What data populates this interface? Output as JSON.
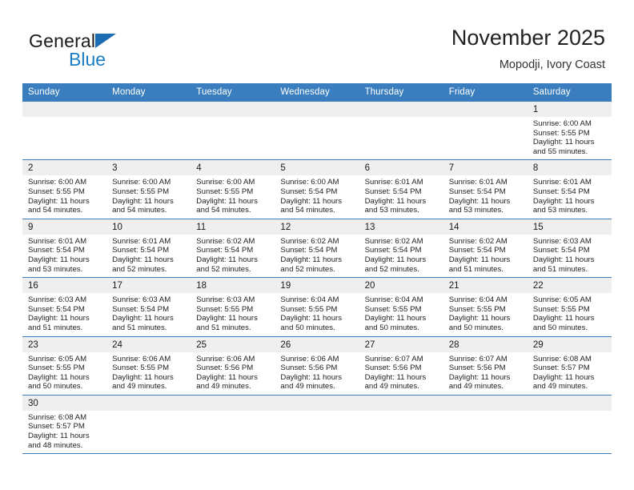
{
  "brand": {
    "name_top": "General",
    "name_bottom": "Blue",
    "accent_color": "#1b6cb3",
    "blue_text_color": "#1b7ec4",
    "triangle_icon": "triangle-icon"
  },
  "header": {
    "title": "November 2025",
    "subtitle": "Mopodji, Ivory Coast"
  },
  "calendar": {
    "header_bg": "#3a7ebf",
    "daynum_bg": "#efefef",
    "weekday_headers": [
      "Sunday",
      "Monday",
      "Tuesday",
      "Wednesday",
      "Thursday",
      "Friday",
      "Saturday"
    ],
    "labels": {
      "sunrise": "Sunrise:",
      "sunset": "Sunset:",
      "daylight": "Daylight:"
    },
    "weeks": [
      [
        {
          "day": "",
          "empty": true
        },
        {
          "day": "",
          "empty": true
        },
        {
          "day": "",
          "empty": true
        },
        {
          "day": "",
          "empty": true
        },
        {
          "day": "",
          "empty": true
        },
        {
          "day": "",
          "empty": true
        },
        {
          "day": "1",
          "sunrise": "Sunrise: 6:00 AM",
          "sunset": "Sunset: 5:55 PM",
          "daylight": "Daylight: 11 hours and 55 minutes."
        }
      ],
      [
        {
          "day": "2",
          "sunrise": "Sunrise: 6:00 AM",
          "sunset": "Sunset: 5:55 PM",
          "daylight": "Daylight: 11 hours and 54 minutes."
        },
        {
          "day": "3",
          "sunrise": "Sunrise: 6:00 AM",
          "sunset": "Sunset: 5:55 PM",
          "daylight": "Daylight: 11 hours and 54 minutes."
        },
        {
          "day": "4",
          "sunrise": "Sunrise: 6:00 AM",
          "sunset": "Sunset: 5:55 PM",
          "daylight": "Daylight: 11 hours and 54 minutes."
        },
        {
          "day": "5",
          "sunrise": "Sunrise: 6:00 AM",
          "sunset": "Sunset: 5:54 PM",
          "daylight": "Daylight: 11 hours and 54 minutes."
        },
        {
          "day": "6",
          "sunrise": "Sunrise: 6:01 AM",
          "sunset": "Sunset: 5:54 PM",
          "daylight": "Daylight: 11 hours and 53 minutes."
        },
        {
          "day": "7",
          "sunrise": "Sunrise: 6:01 AM",
          "sunset": "Sunset: 5:54 PM",
          "daylight": "Daylight: 11 hours and 53 minutes."
        },
        {
          "day": "8",
          "sunrise": "Sunrise: 6:01 AM",
          "sunset": "Sunset: 5:54 PM",
          "daylight": "Daylight: 11 hours and 53 minutes."
        }
      ],
      [
        {
          "day": "9",
          "sunrise": "Sunrise: 6:01 AM",
          "sunset": "Sunset: 5:54 PM",
          "daylight": "Daylight: 11 hours and 53 minutes."
        },
        {
          "day": "10",
          "sunrise": "Sunrise: 6:01 AM",
          "sunset": "Sunset: 5:54 PM",
          "daylight": "Daylight: 11 hours and 52 minutes."
        },
        {
          "day": "11",
          "sunrise": "Sunrise: 6:02 AM",
          "sunset": "Sunset: 5:54 PM",
          "daylight": "Daylight: 11 hours and 52 minutes."
        },
        {
          "day": "12",
          "sunrise": "Sunrise: 6:02 AM",
          "sunset": "Sunset: 5:54 PM",
          "daylight": "Daylight: 11 hours and 52 minutes."
        },
        {
          "day": "13",
          "sunrise": "Sunrise: 6:02 AM",
          "sunset": "Sunset: 5:54 PM",
          "daylight": "Daylight: 11 hours and 52 minutes."
        },
        {
          "day": "14",
          "sunrise": "Sunrise: 6:02 AM",
          "sunset": "Sunset: 5:54 PM",
          "daylight": "Daylight: 11 hours and 51 minutes."
        },
        {
          "day": "15",
          "sunrise": "Sunrise: 6:03 AM",
          "sunset": "Sunset: 5:54 PM",
          "daylight": "Daylight: 11 hours and 51 minutes."
        }
      ],
      [
        {
          "day": "16",
          "sunrise": "Sunrise: 6:03 AM",
          "sunset": "Sunset: 5:54 PM",
          "daylight": "Daylight: 11 hours and 51 minutes."
        },
        {
          "day": "17",
          "sunrise": "Sunrise: 6:03 AM",
          "sunset": "Sunset: 5:54 PM",
          "daylight": "Daylight: 11 hours and 51 minutes."
        },
        {
          "day": "18",
          "sunrise": "Sunrise: 6:03 AM",
          "sunset": "Sunset: 5:55 PM",
          "daylight": "Daylight: 11 hours and 51 minutes."
        },
        {
          "day": "19",
          "sunrise": "Sunrise: 6:04 AM",
          "sunset": "Sunset: 5:55 PM",
          "daylight": "Daylight: 11 hours and 50 minutes."
        },
        {
          "day": "20",
          "sunrise": "Sunrise: 6:04 AM",
          "sunset": "Sunset: 5:55 PM",
          "daylight": "Daylight: 11 hours and 50 minutes."
        },
        {
          "day": "21",
          "sunrise": "Sunrise: 6:04 AM",
          "sunset": "Sunset: 5:55 PM",
          "daylight": "Daylight: 11 hours and 50 minutes."
        },
        {
          "day": "22",
          "sunrise": "Sunrise: 6:05 AM",
          "sunset": "Sunset: 5:55 PM",
          "daylight": "Daylight: 11 hours and 50 minutes."
        }
      ],
      [
        {
          "day": "23",
          "sunrise": "Sunrise: 6:05 AM",
          "sunset": "Sunset: 5:55 PM",
          "daylight": "Daylight: 11 hours and 50 minutes."
        },
        {
          "day": "24",
          "sunrise": "Sunrise: 6:06 AM",
          "sunset": "Sunset: 5:55 PM",
          "daylight": "Daylight: 11 hours and 49 minutes."
        },
        {
          "day": "25",
          "sunrise": "Sunrise: 6:06 AM",
          "sunset": "Sunset: 5:56 PM",
          "daylight": "Daylight: 11 hours and 49 minutes."
        },
        {
          "day": "26",
          "sunrise": "Sunrise: 6:06 AM",
          "sunset": "Sunset: 5:56 PM",
          "daylight": "Daylight: 11 hours and 49 minutes."
        },
        {
          "day": "27",
          "sunrise": "Sunrise: 6:07 AM",
          "sunset": "Sunset: 5:56 PM",
          "daylight": "Daylight: 11 hours and 49 minutes."
        },
        {
          "day": "28",
          "sunrise": "Sunrise: 6:07 AM",
          "sunset": "Sunset: 5:56 PM",
          "daylight": "Daylight: 11 hours and 49 minutes."
        },
        {
          "day": "29",
          "sunrise": "Sunrise: 6:08 AM",
          "sunset": "Sunset: 5:57 PM",
          "daylight": "Daylight: 11 hours and 49 minutes."
        }
      ],
      [
        {
          "day": "30",
          "sunrise": "Sunrise: 6:08 AM",
          "sunset": "Sunset: 5:57 PM",
          "daylight": "Daylight: 11 hours and 48 minutes."
        },
        {
          "day": "",
          "empty": true
        },
        {
          "day": "",
          "empty": true
        },
        {
          "day": "",
          "empty": true
        },
        {
          "day": "",
          "empty": true
        },
        {
          "day": "",
          "empty": true
        },
        {
          "day": "",
          "empty": true
        }
      ]
    ]
  }
}
